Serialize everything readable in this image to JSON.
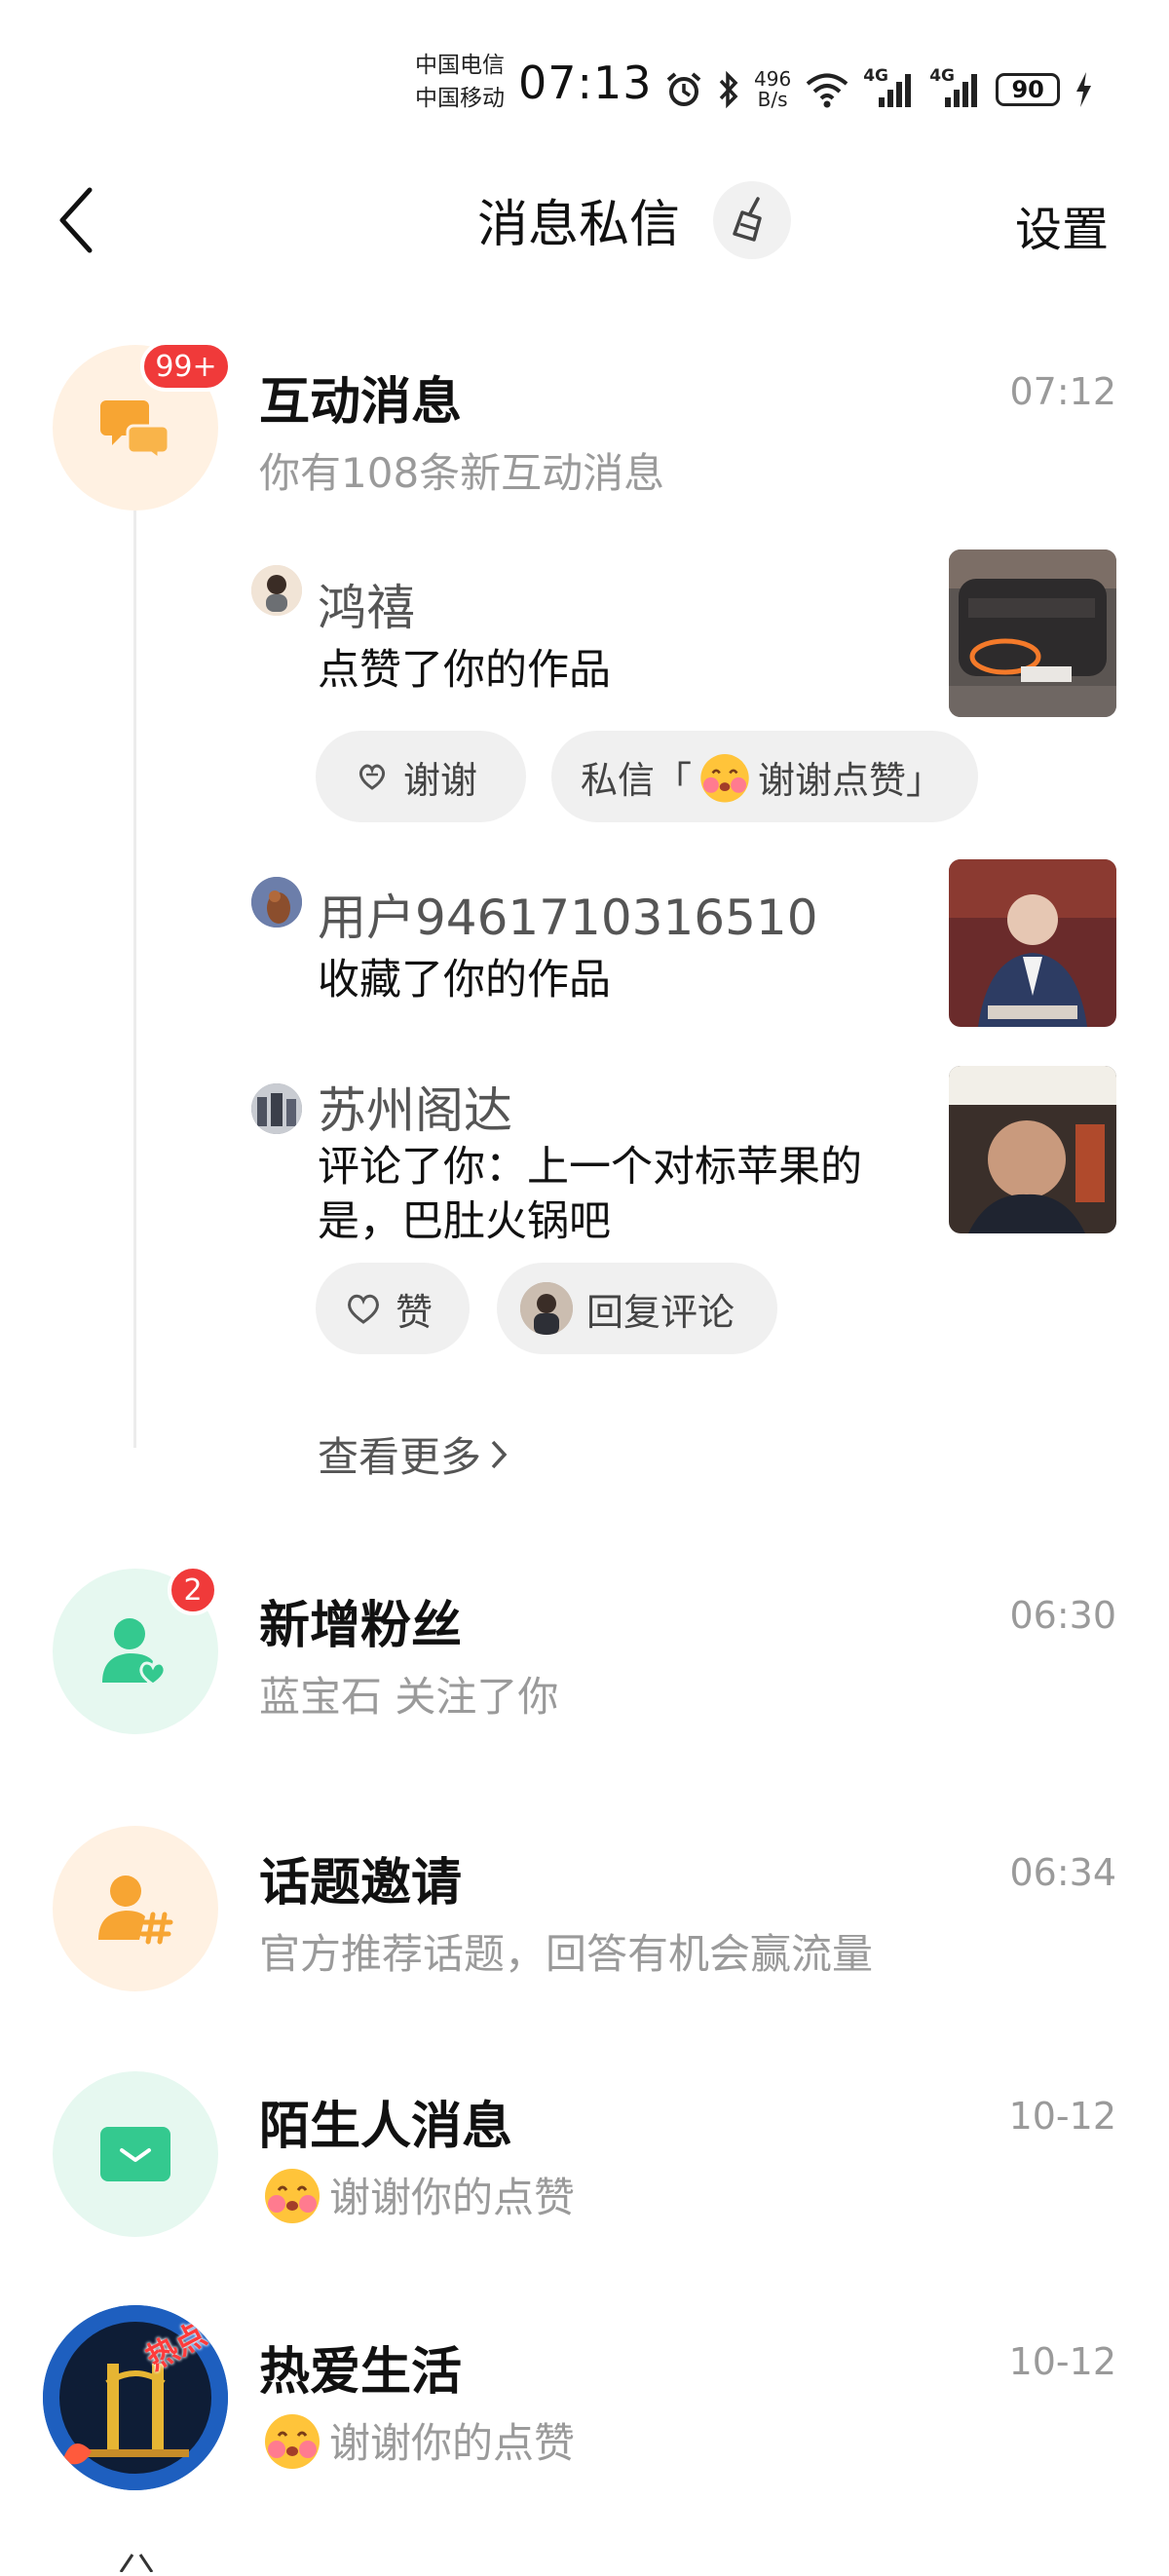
{
  "status_bar": {
    "carrier1": "中国电信",
    "carrier2": "中国移动",
    "time": "07:13",
    "speed_value": "496",
    "speed_unit": "B/s",
    "net1": "4G",
    "net2": "4G",
    "battery": "90"
  },
  "header": {
    "title": "消息私信",
    "settings": "设置",
    "back_icon": "chevron-left-icon",
    "clear_icon": "broom-icon"
  },
  "interactions": {
    "title": "互动消息",
    "subtitle": "你有108条新互动消息",
    "time": "07:12",
    "badge": "99+",
    "items": [
      {
        "name": "鸿禧",
        "text": "点赞了你的作品",
        "actions": [
          "谢谢"
        ],
        "dm_prefix": "私信「",
        "dm_text": "谢谢点赞」"
      },
      {
        "name": "用户9461710316510",
        "text": "收藏了你的作品"
      },
      {
        "name": "苏州阁达",
        "text_line1": "评论了你：上一个对标苹果的",
        "text_line2": "是，巴肚火锅吧",
        "actions": [
          "赞",
          "回复评论"
        ]
      }
    ],
    "see_more": "查看更多"
  },
  "rows": [
    {
      "title": "新增粉丝",
      "subtitle": "蓝宝石 关注了你",
      "time": "06:30",
      "badge": "2"
    },
    {
      "title": "话题邀请",
      "subtitle": "官方推荐话题，回答有机会赢流量",
      "time": "06:34"
    },
    {
      "title": "陌生人消息",
      "subtitle": "谢谢你的点赞",
      "time": "10-12"
    },
    {
      "title": "热爱生活",
      "subtitle": "谢谢你的点赞",
      "time": "10-12",
      "avatar_tag": "热点侠"
    }
  ],
  "colors": {
    "badge_red": "#f03a3a",
    "orange_icon": "#f7a533",
    "orange_bg": "#fff1e2",
    "green_icon": "#34c98f",
    "green_bg": "#e6f8f0"
  }
}
